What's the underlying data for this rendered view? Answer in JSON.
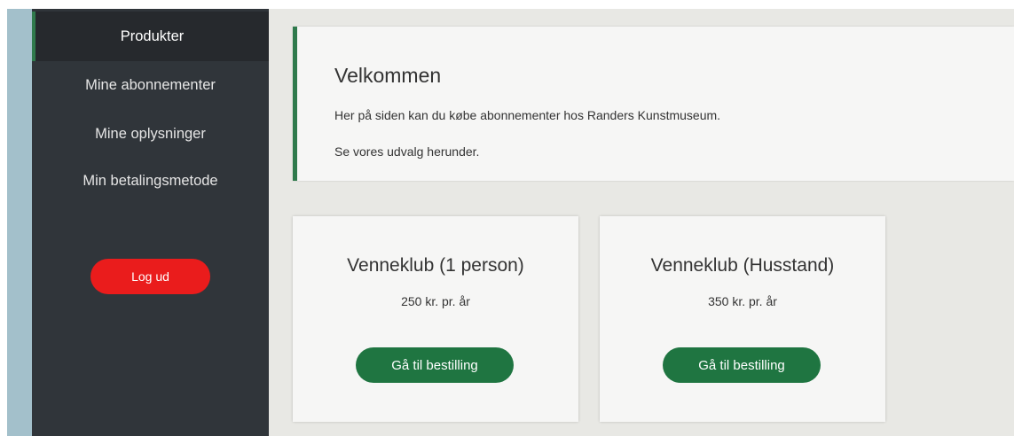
{
  "sidebar": {
    "items": [
      {
        "label": "Produkter",
        "active": true
      },
      {
        "label": "Mine abonnementer",
        "active": false
      },
      {
        "label": "Mine oplysninger",
        "active": false
      },
      {
        "label": "Min betalingsmetode",
        "active": false
      }
    ],
    "logout_label": "Log ud"
  },
  "welcome": {
    "title": "Velkommen",
    "line1": "Her på siden kan du købe abonnementer hos Randers Kunstmuseum.",
    "line2": "Se vores udvalg herunder."
  },
  "products": [
    {
      "title": "Venneklub (1 person)",
      "price": "250 kr. pr. år",
      "button_label": "Gå til bestilling"
    },
    {
      "title": "Venneklub (Husstand)",
      "price": "350 kr. pr. år",
      "button_label": "Gå til bestilling"
    }
  ],
  "colors": {
    "sidebar_bg": "#30353a",
    "accent_green": "#2f7a4c",
    "button_green": "#1f7541",
    "logout_red": "#ea1c1c",
    "page_bg": "#e8e8e4"
  }
}
